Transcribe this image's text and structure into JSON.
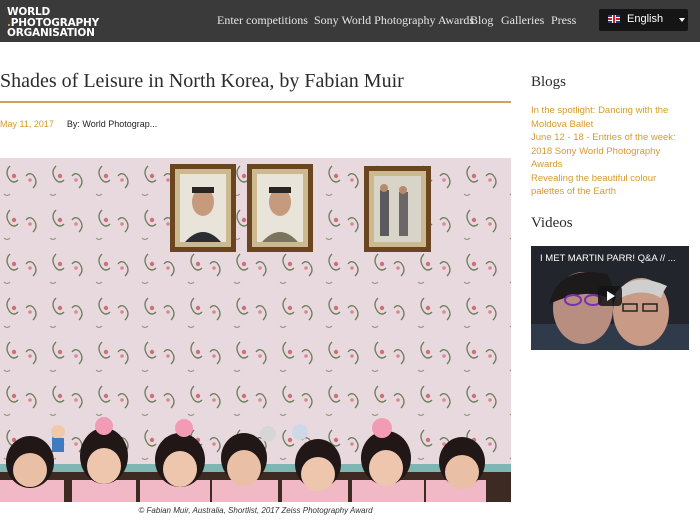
{
  "logo": {
    "line1": "WORLD",
    "line2": "PHOTOGRAPHY",
    "line3": "ORGANISATION"
  },
  "nav": {
    "items": [
      {
        "label": "Enter competitions"
      },
      {
        "label": "Sony World Photography Awards"
      },
      {
        "label": "Blog"
      },
      {
        "label": "Galleries"
      },
      {
        "label": "Press"
      }
    ]
  },
  "language": {
    "label": "English",
    "flag_icon": "uk-flag-icon"
  },
  "article": {
    "title": "Shades of Leisure in North Korea, by Fabian Muir",
    "date": "May 11, 2017",
    "author": "By: World Photograp...",
    "caption": "© Fabian Muir, Australia, Shortlist, 2017 Zeiss Photography Award"
  },
  "sidebar": {
    "blogs_heading": "Blogs",
    "blogs": [
      {
        "label": "In the spotlight: Dancing with the Moldova Ballet"
      },
      {
        "label": "June 12 - 18 - Entries of the week: 2018 Sony World Photography Awards"
      },
      {
        "label": "Revealing the beautiful colour palettes of the Earth"
      }
    ],
    "videos_heading": "Videos",
    "video": {
      "title": "I MET MARTIN PARR! Q&A // ..."
    }
  },
  "colors": {
    "header_bg": "#3a3a3a",
    "accent": "#d69a2d",
    "rule": "#c9a65a"
  }
}
